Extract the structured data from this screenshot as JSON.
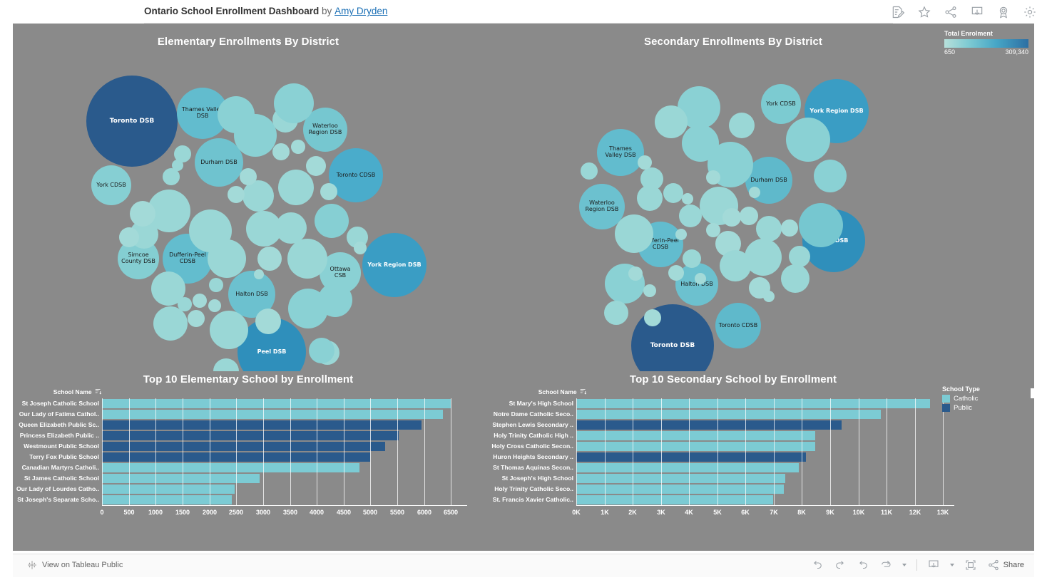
{
  "topbar": {
    "title": "Ontario School Enrollment Dashboard",
    "by": "by",
    "author": "Amy Dryden",
    "icons": [
      "edit-viz-icon",
      "favorite-star-icon",
      "share-icon",
      "download-icon",
      "badge-icon",
      "settings-gear-icon"
    ]
  },
  "color_legend": {
    "title": "Total Enrolment",
    "min": "650",
    "max": "309,340",
    "ramp_start": "#b7e0da",
    "ramp_end": "#2d6fa3"
  },
  "school_type_legend": {
    "title": "School Type",
    "items": [
      {
        "label": "Catholic",
        "color": "#7ccbd4"
      },
      {
        "label": "Public",
        "color": "#2a5a8c"
      }
    ]
  },
  "footer": {
    "view_label": "View on Tableau Public",
    "share_label": "Share",
    "icons": [
      "undo-icon",
      "redo-icon",
      "revert-icon",
      "refresh-icon",
      "pause-icon",
      "download-icon",
      "fullscreen-icon",
      "share-icon"
    ]
  },
  "chart_data": [
    {
      "type": "bubble",
      "title": "Elementary Enrollments By District",
      "value_field": "Total Enrolment",
      "color_scale": {
        "min": 650,
        "max": 309340,
        "min_color": "#b7e0da",
        "max_color": "#2d6fa3"
      },
      "labeled_bubbles": [
        {
          "label": "Toronto DSB",
          "value": 309340
        },
        {
          "label": "Thames Valley\nDSB",
          "value": 50000
        },
        {
          "label": "Waterloo\nRegion DSB",
          "value": 40000
        },
        {
          "label": "Durham DSB",
          "value": 44000
        },
        {
          "label": "Toronto CDSB",
          "value": 56000
        },
        {
          "label": "York CDSB",
          "value": 33000
        },
        {
          "label": "Simcoe\nCounty DSB",
          "value": 33000
        },
        {
          "label": "Dufferin-Peel\nCDSB",
          "value": 45000
        },
        {
          "label": "Halton DSB",
          "value": 42000
        },
        {
          "label": "Ottawa\nCSB",
          "value": 34000
        },
        {
          "label": "York Region DSB",
          "value": 78000
        },
        {
          "label": "Peel DSB",
          "value": 108000
        }
      ]
    },
    {
      "type": "bubble",
      "title": "Secondary Enrollments By District",
      "value_field": "Total Enrolment",
      "color_scale": {
        "min": 650,
        "max": 309340,
        "min_color": "#b7e0da",
        "max_color": "#2d6fa3"
      },
      "labeled_bubbles": [
        {
          "label": "York CDSB",
          "value": 25000
        },
        {
          "label": "York Region DSB",
          "value": 60000
        },
        {
          "label": "Thames\nValley DSB",
          "value": 26000
        },
        {
          "label": "Waterloo\nRegion DSB",
          "value": 24000
        },
        {
          "label": "Durham DSB",
          "value": 31000
        },
        {
          "label": "Dufferin-Peel\nCDSB",
          "value": 28000
        },
        {
          "label": "Peel DSB",
          "value": 58000
        },
        {
          "label": "Halton DSB",
          "value": 25000
        },
        {
          "label": "Toronto CDSB",
          "value": 28000
        },
        {
          "label": "Toronto DSB",
          "value": 130000
        }
      ]
    },
    {
      "type": "bar",
      "title": "Top 10 Elementary School by Enrollment",
      "orientation": "horizontal",
      "header": "School Name",
      "xlabel": "",
      "ylabel": "School Name",
      "xlim": [
        0,
        6800
      ],
      "ticks": [
        "0",
        "500",
        "1000",
        "1500",
        "2000",
        "2500",
        "3000",
        "3500",
        "4000",
        "4500",
        "5000",
        "5500",
        "6000",
        "6500"
      ],
      "tick_values": [
        0,
        500,
        1000,
        1500,
        2000,
        2500,
        3000,
        3500,
        4000,
        4500,
        5000,
        5500,
        6000,
        6500
      ],
      "grid": true,
      "categories": [
        "St Joseph Catholic School",
        "Our Lady of Fatima Cathol..",
        "Queen Elizabeth Public Sc..",
        "Princess Elizabeth Public ..",
        "Westmount Public School",
        "Terry Fox Public School",
        "Canadian Martyrs Catholi..",
        "St James Catholic School",
        "Our Lady of Lourdes Catho..",
        "St Joseph's Separate Scho.."
      ],
      "values": [
        6500,
        6350,
        5950,
        5530,
        5270,
        4990,
        4790,
        2940,
        2470,
        2420
      ],
      "colors": [
        "#7ccbd4",
        "#7ccbd4",
        "#2a5a8c",
        "#2a5a8c",
        "#2a5a8c",
        "#2a5a8c",
        "#7ccbd4",
        "#7ccbd4",
        "#7ccbd4",
        "#7ccbd4"
      ],
      "series_field": "School Type"
    },
    {
      "type": "bar",
      "title": "Top 10 Secondary School by Enrollment",
      "orientation": "horizontal",
      "header": "School Name",
      "xlabel": "",
      "ylabel": "School Name",
      "xlim": [
        0,
        13400
      ],
      "ticks": [
        "0K",
        "1K",
        "2K",
        "3K",
        "4K",
        "5K",
        "6K",
        "7K",
        "8K",
        "9K",
        "10K",
        "11K",
        "12K",
        "13K"
      ],
      "tick_values": [
        0,
        1000,
        2000,
        3000,
        4000,
        5000,
        6000,
        7000,
        8000,
        9000,
        10000,
        11000,
        12000,
        13000
      ],
      "grid": true,
      "categories": [
        "St Mary's High School",
        "Notre Dame Catholic Seco..",
        "Stephen Lewis Secondary ..",
        "Holy Trinity Catholic High ..",
        "Holy Cross Catholic Secon..",
        "Huron Heights Secondary ..",
        "St Thomas Aquinas Secon..",
        "St Joseph's High School",
        "Holy Trinity Catholic Seco..",
        "St. Francis Xavier Catholic.."
      ],
      "values": [
        12550,
        10800,
        9400,
        8480,
        8470,
        8130,
        7880,
        7400,
        7350,
        6980
      ],
      "colors": [
        "#7ccbd4",
        "#7ccbd4",
        "#2a5a8c",
        "#7ccbd4",
        "#7ccbd4",
        "#2a5a8c",
        "#7ccbd4",
        "#7ccbd4",
        "#7ccbd4",
        "#7ccbd4"
      ],
      "series_field": "School Type"
    }
  ],
  "bubble_layout": {
    "elementary": [
      [
        167,
        137,
        64,
        "#2a5a8c",
        "Toronto DSB",
        1,
        1
      ],
      [
        266,
        126,
        36,
        "#62bcce",
        "Thames Valley\nDSB",
        0,
        0
      ],
      [
        438,
        149,
        31,
        "#76c7d0",
        "Waterloo\nRegion DSB",
        0,
        0
      ],
      [
        289,
        195,
        34,
        "#6fc3cf",
        "Durham DSB",
        0,
        0
      ],
      [
        481,
        213,
        38,
        "#4aaccb",
        "Toronto CDSB",
        0,
        0
      ],
      [
        138,
        227,
        28,
        "#86cfd3",
        "York CDSB",
        0,
        0
      ],
      [
        176,
        330,
        29,
        "#84ced2",
        "Simcoe\nCounty DSB",
        0,
        0
      ],
      [
        245,
        330,
        35,
        "#63bdce",
        "Dufferin-Peel\nCDSB",
        0,
        0
      ],
      [
        335,
        380,
        33,
        "#6cc1cf",
        "Halton DSB",
        0,
        0
      ],
      [
        459,
        350,
        29,
        "#8ad1d4",
        "Ottawa\nCSB",
        0,
        0
      ],
      [
        535,
        339,
        45,
        "#3a9dc4",
        "York Region DSB",
        1,
        0
      ],
      [
        363,
        461,
        48,
        "#2f8fbb",
        "Peel DSB",
        1,
        0
      ],
      [
        340,
        157,
        30,
        "#8ad1d4",
        "",
        0,
        0
      ],
      [
        382,
        135,
        18,
        "#9ad7d6",
        "",
        0,
        0
      ],
      [
        219,
        263,
        30,
        "#9ad7d6",
        "",
        0,
        0
      ],
      [
        238,
        183,
        12,
        "#9ad7d6",
        "",
        0,
        0
      ],
      [
        231,
        199,
        8,
        "#9ad7d6",
        "",
        0,
        0
      ],
      [
        222,
        215,
        12,
        "#9ad7d6",
        "",
        0,
        0
      ],
      [
        184,
        296,
        20,
        "#9ad7d6",
        "",
        0,
        0
      ],
      [
        218,
        372,
        24,
        "#9ad7d6",
        "",
        0,
        0
      ],
      [
        221,
        421,
        24,
        "#9ad7d6",
        "",
        0,
        0
      ],
      [
        277,
        291,
        30,
        "#9ad7d6",
        "",
        0,
        0
      ],
      [
        285,
        367,
        10,
        "#9ad7d6",
        "",
        0,
        0
      ],
      [
        241,
        394,
        10,
        "#9ad7d6",
        "",
        0,
        0
      ],
      [
        262,
        389,
        10,
        "#a3dad8",
        "",
        0,
        0
      ],
      [
        283,
        396,
        9,
        "#a3dad8",
        "",
        0,
        0
      ],
      [
        300,
        330,
        27,
        "#9ad7d6",
        "",
        0,
        0
      ],
      [
        303,
        430,
        27,
        "#9ad7d6",
        "",
        0,
        0
      ],
      [
        352,
        288,
        25,
        "#9ad7d6",
        "",
        0,
        0
      ],
      [
        344,
        242,
        22,
        "#9ad7d6",
        "",
        0,
        0
      ],
      [
        313,
        240,
        12,
        "#a3dad8",
        "",
        0,
        0
      ],
      [
        330,
        215,
        12,
        "#a3dad8",
        "",
        0,
        0
      ],
      [
        360,
        330,
        17,
        "#a3dad8",
        "",
        0,
        0
      ],
      [
        345,
        352,
        7,
        "#a3dad8",
        "",
        0,
        0
      ],
      [
        358,
        418,
        18,
        "#a3dad8",
        "",
        0,
        0
      ],
      [
        390,
        287,
        22,
        "#9ad7d6",
        "",
        0,
        0
      ],
      [
        397,
        230,
        25,
        "#9ad7d6",
        "",
        0,
        0
      ],
      [
        376,
        180,
        12,
        "#a3dad8",
        "",
        0,
        0
      ],
      [
        400,
        173,
        10,
        "#a3dad8",
        "",
        0,
        0
      ],
      [
        413,
        330,
        28,
        "#9ad7d6",
        "",
        0,
        0
      ],
      [
        414,
        400,
        28,
        "#8ad1d4",
        "",
        0,
        0
      ],
      [
        441,
        462,
        17,
        "#9ad7d6",
        "",
        0,
        0
      ],
      [
        447,
        277,
        24,
        "#86cfd3",
        "",
        0,
        0
      ],
      [
        443,
        236,
        12,
        "#a3dad8",
        "",
        0,
        0
      ],
      [
        425,
        200,
        14,
        "#a3dad8",
        "",
        0,
        0
      ],
      [
        483,
        300,
        15,
        "#9ad7d6",
        "",
        0,
        0
      ],
      [
        487,
        315,
        9,
        "#a3dad8",
        "",
        0,
        0
      ],
      [
        452,
        388,
        24,
        "#8ad1d4",
        "",
        0,
        0
      ],
      [
        394,
        112,
        28,
        "#8ad1d4",
        "",
        0,
        0
      ],
      [
        313,
        128,
        26,
        "#8ad1d4",
        "",
        0,
        0
      ],
      [
        182,
        267,
        18,
        "#a3dad8",
        "",
        0,
        0
      ],
      [
        163,
        300,
        14,
        "#a3dad8",
        "",
        0,
        0
      ],
      [
        299,
        488,
        18,
        "#9ad7d6",
        "",
        0,
        0
      ],
      [
        257,
        414,
        12,
        "#a3dad8",
        "",
        0,
        0
      ],
      [
        433,
        459,
        18,
        "#8ad1d4",
        "",
        0,
        0
      ]
    ],
    "secondary": [
      [
        1077,
        113,
        28,
        "#7ccbd1",
        "York CDSB",
        0,
        0
      ],
      [
        1155,
        123,
        45,
        "#3a9dc4",
        "York Region DSB",
        1,
        0
      ],
      [
        1115,
        163,
        31,
        "#8ad1d4",
        "",
        0,
        0
      ],
      [
        852,
        181,
        33,
        "#62bcce",
        "Thames\nValley DSB",
        0,
        0
      ],
      [
        826,
        257,
        32,
        "#6cc1cf",
        "Waterloo\nRegion DSB",
        0,
        0
      ],
      [
        1060,
        220,
        33,
        "#5fb9cb",
        "Durham DSB",
        0,
        0
      ],
      [
        908,
        310,
        32,
        "#62bcce",
        "Dufferin-Peel\nCDSB",
        0,
        0
      ],
      [
        1151,
        305,
        44,
        "#2f8fbb",
        "Peel DSB",
        1,
        0
      ],
      [
        959,
        366,
        30,
        "#6cc1cf",
        "Halton DSB",
        0,
        0
      ],
      [
        1017,
        424,
        32,
        "#5fb9cb",
        "Toronto CDSB",
        0,
        0
      ],
      [
        925,
        452,
        58,
        "#2a5a8c",
        "Toronto DSB",
        1,
        1
      ],
      [
        962,
        118,
        30,
        "#8ad1d4",
        "",
        0,
        0
      ],
      [
        923,
        138,
        23,
        "#9ad7d6",
        "",
        0,
        0
      ],
      [
        964,
        168,
        26,
        "#8ad1d4",
        "",
        0,
        0
      ],
      [
        1022,
        143,
        18,
        "#9ad7d6",
        "",
        0,
        0
      ],
      [
        1006,
        198,
        32,
        "#8ad1d4",
        "",
        0,
        0
      ],
      [
        1146,
        214,
        23,
        "#8ad1d4",
        "",
        0,
        0
      ],
      [
        1133,
        283,
        31,
        "#76c7d0",
        "",
        0,
        0
      ],
      [
        896,
        218,
        16,
        "#9ad7d6",
        "",
        0,
        0
      ],
      [
        808,
        207,
        12,
        "#9ad7d6",
        "",
        0,
        0
      ],
      [
        886,
        195,
        10,
        "#a3dad8",
        "",
        0,
        0
      ],
      [
        893,
        245,
        18,
        "#9ad7d6",
        "",
        0,
        0
      ],
      [
        871,
        295,
        27,
        "#9ad7d6",
        "",
        0,
        0
      ],
      [
        858,
        365,
        28,
        "#8ad1d4",
        "",
        0,
        0
      ],
      [
        846,
        406,
        17,
        "#9ad7d6",
        "",
        0,
        0
      ],
      [
        893,
        375,
        9,
        "#a3dad8",
        "",
        0,
        0
      ],
      [
        873,
        351,
        10,
        "#a3dad8",
        "",
        0,
        0
      ],
      [
        926,
        238,
        14,
        "#9ad7d6",
        "",
        0,
        0
      ],
      [
        946,
        246,
        8,
        "#a3dad8",
        "",
        0,
        0
      ],
      [
        950,
        270,
        16,
        "#9ad7d6",
        "",
        0,
        0
      ],
      [
        990,
        256,
        27,
        "#9ad7d6",
        "",
        0,
        0
      ],
      [
        937,
        296,
        8,
        "#a3dad8",
        "",
        0,
        0
      ],
      [
        952,
        330,
        13,
        "#9ad7d6",
        "",
        0,
        0
      ],
      [
        1003,
        309,
        18,
        "#a3dad8",
        "",
        0,
        0
      ],
      [
        1013,
        340,
        22,
        "#9ad7d6",
        "",
        0,
        0
      ],
      [
        1008,
        272,
        13,
        "#a3dad8",
        "",
        0,
        0
      ],
      [
        1032,
        270,
        13,
        "#a3dad8",
        "",
        0,
        0
      ],
      [
        1060,
        288,
        18,
        "#9ad7d6",
        "",
        0,
        0
      ],
      [
        1052,
        328,
        26,
        "#9ad7d6",
        "",
        0,
        0
      ],
      [
        1089,
        287,
        12,
        "#a3dad8",
        "",
        0,
        0
      ],
      [
        1097,
        358,
        20,
        "#9ad7d6",
        "",
        0,
        0
      ],
      [
        1047,
        371,
        15,
        "#a3dad8",
        "",
        0,
        0
      ],
      [
        1060,
        383,
        8,
        "#a3dad8",
        "",
        0,
        0
      ],
      [
        1040,
        237,
        8,
        "#a3dad8",
        "",
        0,
        0
      ],
      [
        964,
        358,
        8,
        "#a3dad8",
        "",
        0,
        0
      ],
      [
        982,
        290,
        10,
        "#a3dad8",
        "",
        0,
        0
      ],
      [
        1103,
        327,
        15,
        "#9ad7d6",
        "",
        0,
        0
      ],
      [
        897,
        413,
        12,
        "#a3dad8",
        "",
        0,
        0
      ],
      [
        982,
        216,
        10,
        "#a3dad8",
        "",
        0,
        0
      ],
      [
        930,
        350,
        11,
        "#a3dad8",
        "",
        0,
        0
      ]
    ]
  }
}
